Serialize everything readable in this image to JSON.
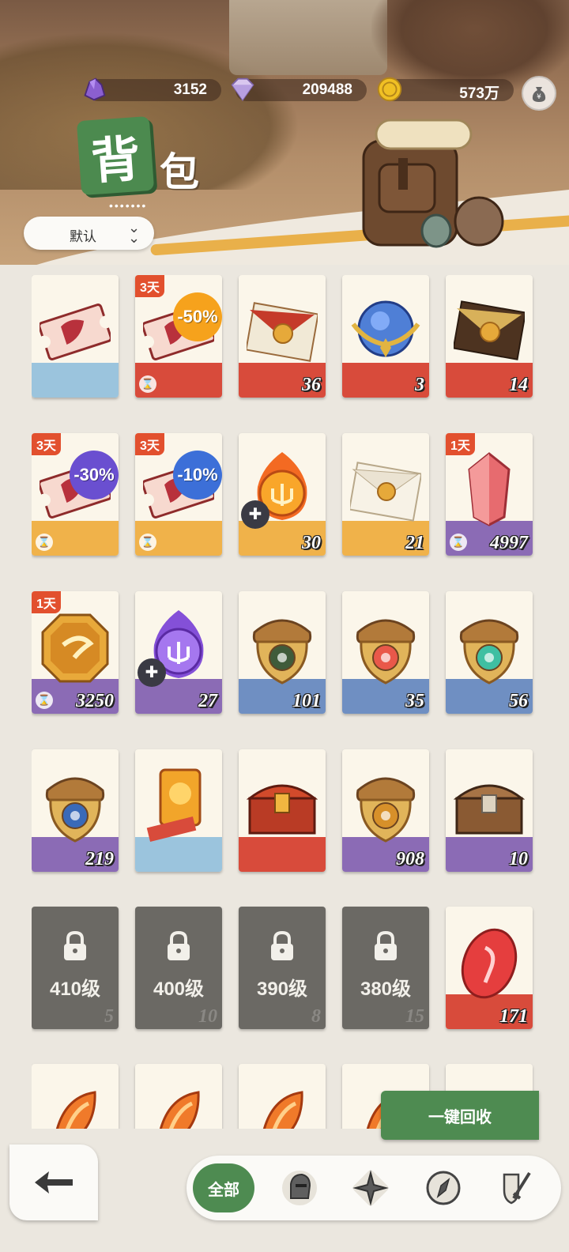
{
  "resources": [
    {
      "name": "purple-crystal",
      "value": "3152"
    },
    {
      "name": "diamond",
      "value": "209488"
    },
    {
      "name": "gold-coin",
      "value": "573万"
    }
  ],
  "title": {
    "main": "背",
    "rest": "包",
    "dots": "•••••••"
  },
  "sort": {
    "label": "默认"
  },
  "items": [
    {
      "count": "",
      "tag": "",
      "timer": false,
      "discount": "",
      "art": "ticket",
      "band": "#9bc4dd"
    },
    {
      "count": "",
      "tag": "3天",
      "timer": true,
      "discount": "-50%",
      "art": "ticket",
      "band": "#d84b3b"
    },
    {
      "count": "36",
      "tag": "",
      "timer": false,
      "discount": "",
      "art": "letter-red",
      "band": "#d84b3b"
    },
    {
      "count": "3",
      "tag": "",
      "timer": false,
      "discount": "",
      "art": "orb-blue",
      "band": "#d84b3b"
    },
    {
      "count": "14",
      "tag": "",
      "timer": false,
      "discount": "",
      "art": "letter-dark",
      "band": "#d84b3b"
    },
    {
      "count": "",
      "tag": "3天",
      "timer": true,
      "discount": "-30%",
      "art": "ticket",
      "band": "#f0b24a"
    },
    {
      "count": "",
      "tag": "3天",
      "timer": true,
      "discount": "-10%",
      "art": "ticket",
      "band": "#f0b24a"
    },
    {
      "count": "30",
      "tag": "",
      "timer": false,
      "discount": "",
      "art": "orb-fire",
      "band": "#f0b24a",
      "piece": true
    },
    {
      "count": "21",
      "tag": "",
      "timer": false,
      "discount": "",
      "art": "letter-white",
      "band": "#f0b24a"
    },
    {
      "count": "4997",
      "tag": "1天",
      "timer": true,
      "discount": "",
      "art": "crystal-red",
      "band": "#8b6bb5"
    },
    {
      "count": "3250",
      "tag": "1天",
      "timer": true,
      "discount": "",
      "art": "badge-gold",
      "band": "#8b6bb5"
    },
    {
      "count": "27",
      "tag": "",
      "timer": false,
      "discount": "",
      "art": "orb-purple",
      "band": "#8b6bb5",
      "piece": true
    },
    {
      "count": "101",
      "tag": "",
      "timer": false,
      "discount": "",
      "art": "acorn-green",
      "band": "#6f8fc2"
    },
    {
      "count": "35",
      "tag": "",
      "timer": false,
      "discount": "",
      "art": "acorn-red",
      "band": "#6f8fc2"
    },
    {
      "count": "56",
      "tag": "",
      "timer": false,
      "discount": "",
      "art": "acorn-teal",
      "band": "#6f8fc2"
    },
    {
      "count": "219",
      "tag": "",
      "timer": false,
      "discount": "",
      "art": "acorn-blue",
      "band": "#8b6bb5"
    },
    {
      "count": "",
      "tag": "",
      "timer": false,
      "discount": "",
      "art": "ticket-gold",
      "band": "#9bc4dd"
    },
    {
      "count": "",
      "tag": "",
      "timer": false,
      "discount": "",
      "art": "chest-red",
      "band": "#d84b3b"
    },
    {
      "count": "908",
      "tag": "",
      "timer": false,
      "discount": "",
      "art": "acorn-gold",
      "band": "#8b6bb5"
    },
    {
      "count": "10",
      "tag": "",
      "timer": false,
      "discount": "",
      "art": "chest-brown",
      "band": "#8b6bb5"
    },
    {
      "count": "5",
      "locked": true,
      "level": "410级"
    },
    {
      "count": "10",
      "locked": true,
      "level": "400级"
    },
    {
      "count": "8",
      "locked": true,
      "level": "390级"
    },
    {
      "count": "15",
      "locked": true,
      "level": "380级"
    },
    {
      "count": "171",
      "tag": "",
      "timer": false,
      "discount": "",
      "art": "gem-red",
      "band": "#d84b3b"
    }
  ],
  "recycle_label": "一键回收",
  "tabs": [
    {
      "label": "全部",
      "icon": "all"
    },
    {
      "label": "",
      "icon": "knight-helmet-icon"
    },
    {
      "label": "",
      "icon": "compass-star-icon"
    },
    {
      "label": "",
      "icon": "compass-icon"
    },
    {
      "label": "",
      "icon": "sword-shield-icon"
    }
  ],
  "colors": {
    "accent_green": "#4e8b51",
    "tag_red": "#e2502e"
  }
}
